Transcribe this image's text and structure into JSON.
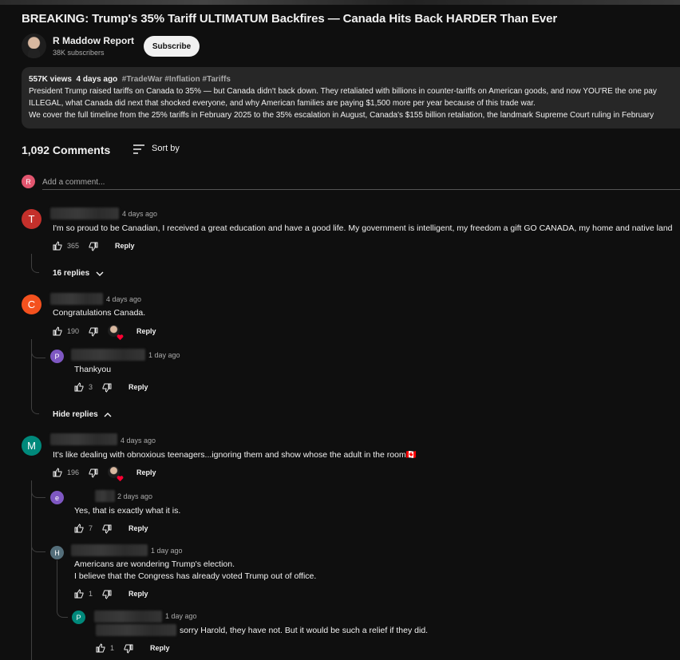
{
  "video": {
    "title": "BREAKING: Trump's 35% Tariff ULTIMATUM Backfires — Canada Hits Back HARDER Than Ever"
  },
  "channel": {
    "name": "R Maddow Report",
    "subscribers": "38K subscribers",
    "subscribe_label": "Subscribe"
  },
  "description": {
    "views": "557K views",
    "age": "4 days ago",
    "tags": "#TradeWar #Inflation #Tariffs",
    "line1": "President Trump raised tariffs on Canada to 35% — but Canada didn't back down. They retaliated with billions in counter-tariffs on American goods, and now YOU'RE the one pay",
    "line2": "ILLEGAL, what Canada did next that shocked everyone, and why American families are paying $1,500 more per year because of this trade war.",
    "line3": "We cover the full timeline from the 25% tariffs in February 2025 to the 35% escalation in August, Canada's $155 billion retaliation, the landmark Supreme Court ruling in February"
  },
  "comments_header": {
    "count": "1,092 Comments",
    "sort_label": "Sort by"
  },
  "add_comment": {
    "avatar_letter": "R",
    "placeholder": "Add a comment..."
  },
  "comments": [
    {
      "avatar_letter": "T",
      "avatar_color": "#c4302b",
      "time": "4 days ago",
      "text": "I'm so proud to be Canadian, I received a great education and have a good life. My  government is intelligent, my freedom a gift GO CANADA, my home and native land",
      "likes": "365",
      "reply_label": "Reply",
      "replies_toggle": "16 replies"
    },
    {
      "avatar_letter": "C",
      "avatar_color": "#f4511e",
      "time": "4 days ago",
      "text": "Congratulations Canada.",
      "likes": "190",
      "reply_label": "Reply",
      "replies_toggle": "Hide replies",
      "replies": [
        {
          "avatar_letter": "P",
          "avatar_color": "#7e57c2",
          "time": "1 day ago",
          "text": "Thankyou",
          "likes": "3",
          "reply_label": "Reply"
        }
      ]
    },
    {
      "avatar_letter": "M",
      "avatar_color": "#00897b",
      "time": "4 days ago",
      "text": "It's like dealing with obnoxious teenagers...ignoring them and show whose the adult in the room🇨🇦",
      "likes": "196",
      "reply_label": "Reply",
      "replies": [
        {
          "avatar_letter": "e",
          "avatar_color": "#7e57c2",
          "time": "2 days ago",
          "text": "Yes, that is exactly what it is.",
          "likes": "7",
          "reply_label": "Reply"
        },
        {
          "avatar_letter": "H",
          "avatar_color": "#546e7a",
          "time": "1 day ago",
          "text_line1": "Americans are wondering Trump's election.",
          "text_line2": "I believe that the Congress has already voted Trump out of office.",
          "likes": "1",
          "reply_label": "Reply"
        },
        {
          "avatar_letter": "P",
          "avatar_color": "#00897b",
          "time": "1 day ago",
          "text": "sorry Harold, they have not. But it would be such a relief if they did.",
          "likes": "1",
          "reply_label": "Reply"
        }
      ]
    }
  ],
  "icons": {
    "like": "thumbs-up-icon",
    "dislike": "thumbs-down-icon",
    "sort": "sort-icon",
    "chevron_down": "chevron-down-icon",
    "chevron_up": "chevron-up-icon",
    "creator_heart": "creator-heart-icon"
  },
  "colors": {
    "background": "#0f0f0f",
    "description_bg": "#272727",
    "heart": "#ff0033"
  }
}
